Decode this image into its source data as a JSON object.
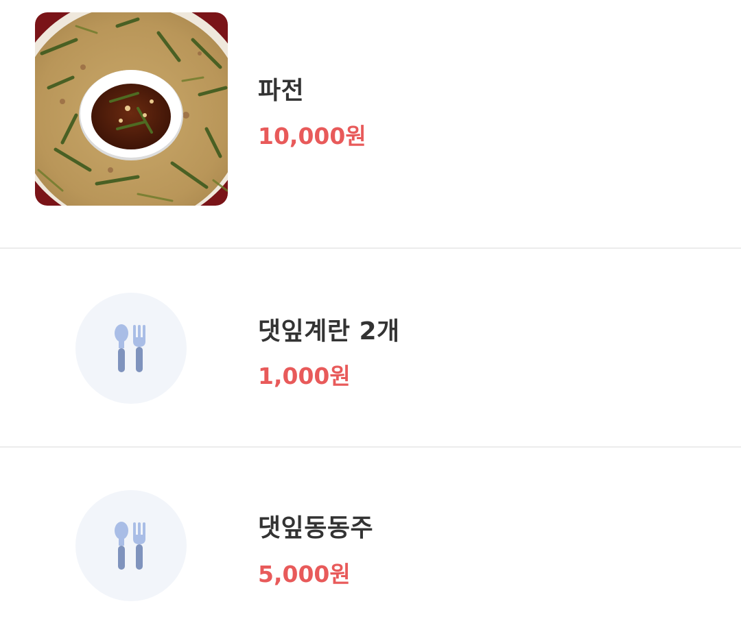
{
  "menu": {
    "items": [
      {
        "name": "파전",
        "price": "10,000원",
        "image": "pajeon-photo"
      },
      {
        "name": "댓잎계란 2개",
        "price": "1,000원",
        "image": "utensils-icon"
      },
      {
        "name": "댓잎동동주",
        "price": "5,000원",
        "image": "utensils-icon"
      }
    ]
  },
  "colors": {
    "name_text": "#333333",
    "price_text": "#e85a5a",
    "placeholder_bg": "#f2f5fa",
    "icon": "#8a9fcc",
    "divider": "#ececec"
  }
}
